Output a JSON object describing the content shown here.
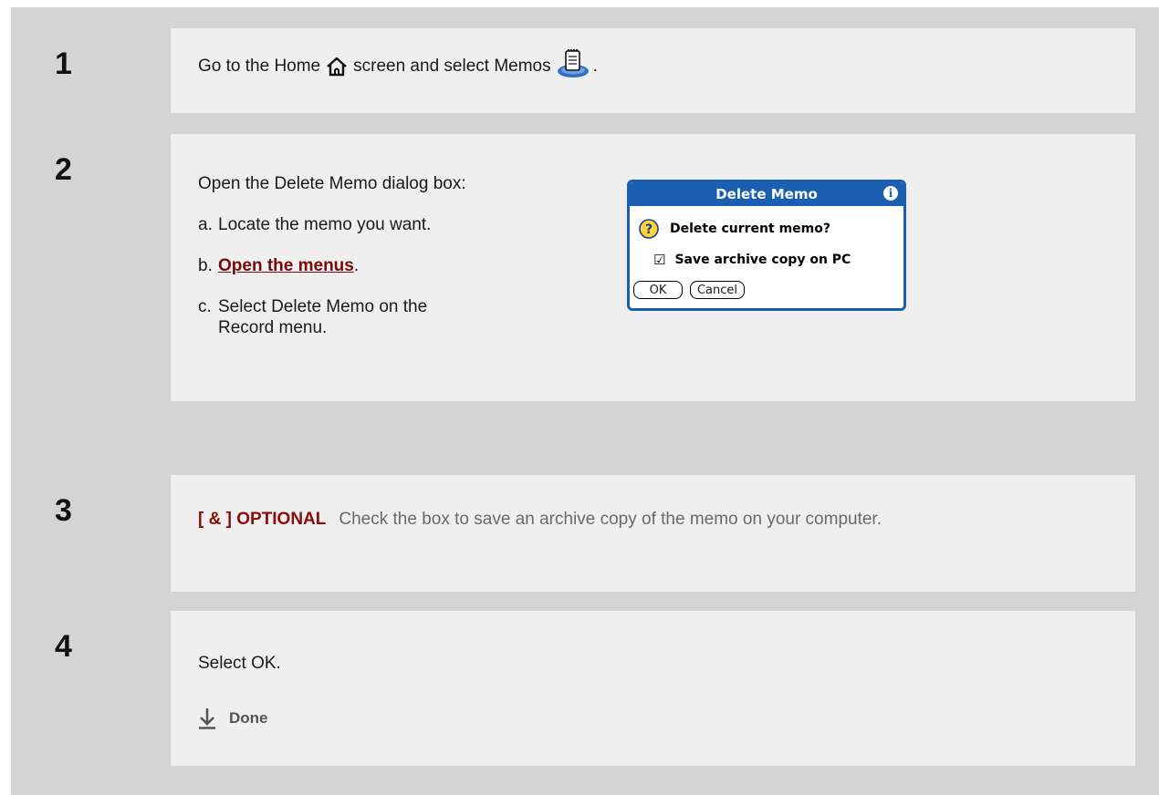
{
  "steps": [
    {
      "number": "1",
      "text_before_home": "Go to the Home",
      "text_middle": "screen and select Memos",
      "text_end": "."
    },
    {
      "number": "2",
      "intro": "Open the Delete Memo dialog box:",
      "substeps": [
        {
          "label": "a.",
          "text": "Locate the memo you want."
        },
        {
          "label": "b.",
          "link": "Open the menus",
          "suffix": "."
        },
        {
          "label": "c.",
          "text": "Select Delete Memo on the Record menu."
        }
      ],
      "dialog": {
        "title": "Delete Memo",
        "info_glyph": "i",
        "question": "Delete current memo?",
        "checkbox_glyph": "☑",
        "checkbox_label": "Save archive copy on PC",
        "ok_label": "OK",
        "cancel_label": "Cancel"
      }
    },
    {
      "number": "3",
      "tag": "[ & ]  OPTIONAL",
      "text": "Check the box to save an archive copy of the memo on your computer."
    },
    {
      "number": "4",
      "text": "Select OK.",
      "done_label": "Done"
    }
  ],
  "icons": [
    "home-icon",
    "memos-icon",
    "question-icon",
    "info-icon",
    "done-arrow-icon"
  ],
  "colors": {
    "number_column": "#d4d4d4",
    "content_background": "#efefef",
    "optional_tag": "#8b0b0b",
    "link": "#7a0a0a",
    "dialog_blue": "#1a5fb0"
  }
}
